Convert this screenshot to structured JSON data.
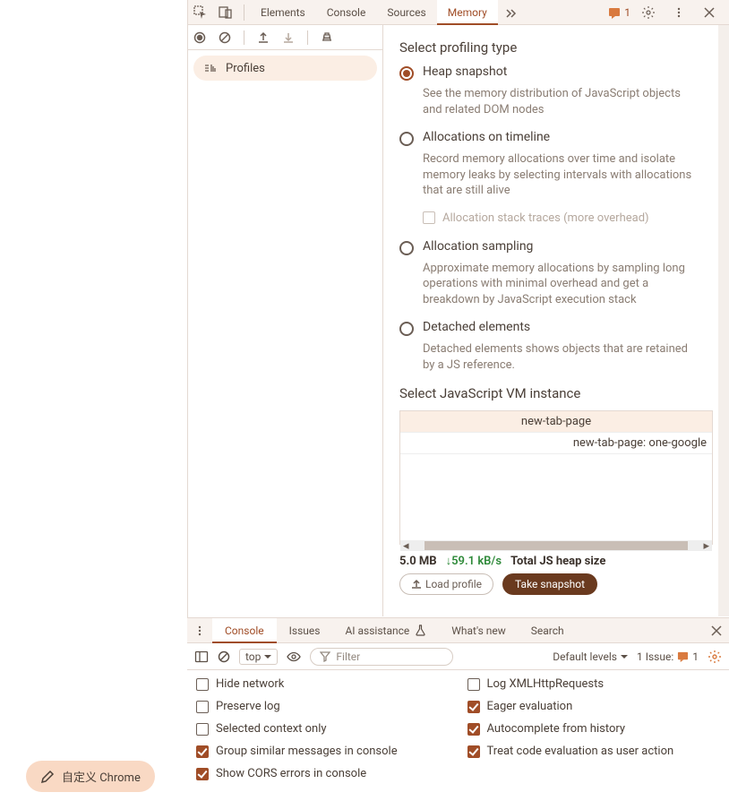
{
  "topTabs": {
    "elements": "Elements",
    "console": "Console",
    "sources": "Sources",
    "memory": "Memory",
    "issuesCount": "1"
  },
  "sidebar": {
    "profiles": "Profiles"
  },
  "profiling": {
    "title": "Select profiling type",
    "heap": {
      "label": "Heap snapshot",
      "desc": "See the memory distribution of JavaScript objects and related DOM nodes"
    },
    "timeline": {
      "label": "Allocations on timeline",
      "desc": "Record memory allocations over time and isolate memory leaks by selecting intervals with allocations that are still alive",
      "sub": "Allocation stack traces (more overhead)"
    },
    "sampling": {
      "label": "Allocation sampling",
      "desc": "Approximate memory allocations by sampling long operations with minimal overhead and get a breakdown by JavaScript execution stack"
    },
    "detached": {
      "label": "Detached elements",
      "desc": "Detached elements shows objects that are retained by a JS reference."
    }
  },
  "vm": {
    "title": "Select JavaScript VM instance",
    "rows": [
      "new-tab-page",
      "new-tab-page: one-google"
    ]
  },
  "heap": {
    "size": "5.0 MB",
    "rate": "↓59.1 kB/s",
    "label": "Total JS heap size"
  },
  "buttons": {
    "load": "Load profile",
    "take": "Take snapshot"
  },
  "drawer": {
    "tabs": {
      "console": "Console",
      "issues": "Issues",
      "ai": "AI assistance",
      "whatsnew": "What's new",
      "search": "Search"
    },
    "toolbar": {
      "context": "top",
      "filterPlaceholder": "Filter",
      "levels": "Default levels",
      "issuesLabel": "1 Issue:",
      "issuesCount": "1"
    },
    "settings": {
      "hideNetwork": "Hide network",
      "preserveLog": "Preserve log",
      "selectedContext": "Selected context only",
      "groupSimilar": "Group similar messages in console",
      "showCors": "Show CORS errors in console",
      "logXhr": "Log XMLHttpRequests",
      "eagerEval": "Eager evaluation",
      "autocomplete": "Autocomplete from history",
      "treatCode": "Treat code evaluation as user action"
    }
  },
  "pill": "自定义 Chrome"
}
